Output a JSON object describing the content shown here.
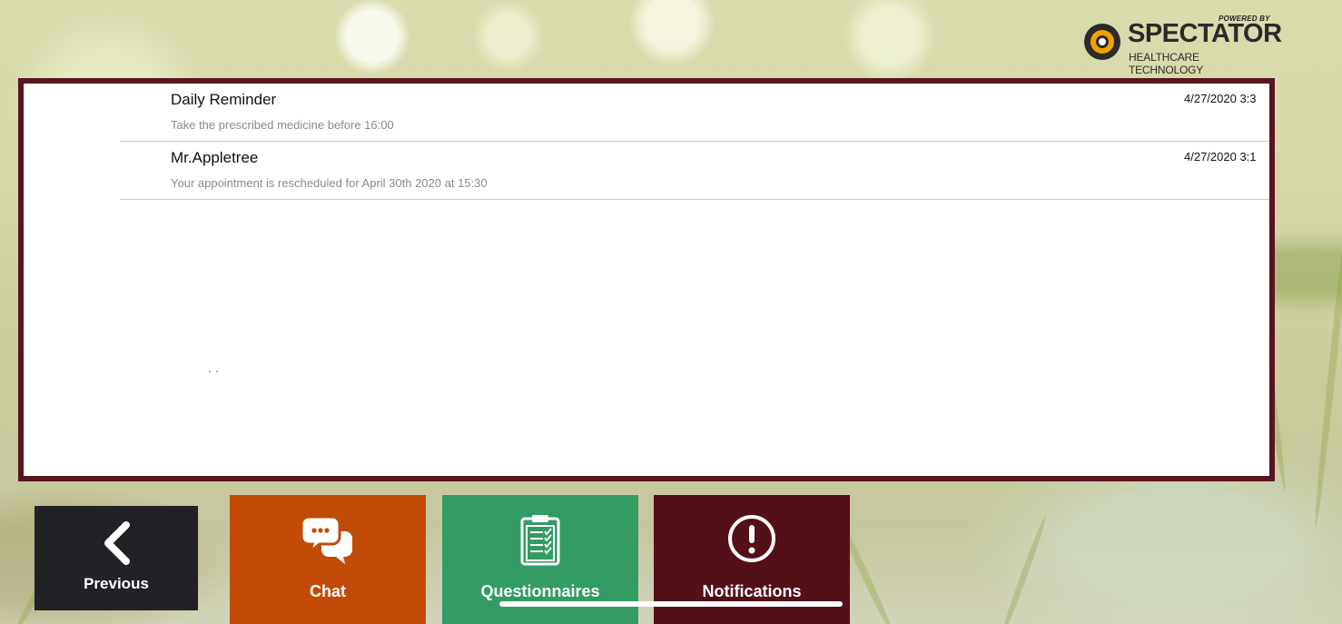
{
  "brand": {
    "powered_by": "POWERED BY",
    "name": "SPECTATOR",
    "tagline": "HEALTHCARE TECHNOLOGY",
    "icon": "spectator-logo-icon"
  },
  "notifications": [
    {
      "title": "Daily Reminder",
      "body": "Take the prescribed medicine before 16:00",
      "date": "4/27/2020 3:3"
    },
    {
      "title": "Mr.Appletree",
      "body": "Your appointment is rescheduled for April 30th 2020 at 15:30",
      "date": "4/27/2020 3:1"
    }
  ],
  "nav": {
    "previous": {
      "label": "Previous",
      "icon": "chevron-left-icon"
    },
    "chat": {
      "label": "Chat",
      "icon": "chat-bubbles-icon"
    },
    "questionnaires": {
      "label": "Questionnaires",
      "icon": "clipboard-icon"
    },
    "notifications": {
      "label": "Notifications",
      "icon": "exclamation-circle-icon"
    }
  },
  "colors": {
    "panel_border": "#5a1420",
    "previous": "#212126",
    "chat": "#c24b08",
    "questionnaires": "#339b64",
    "notifications": "#541019",
    "logo_accent": "#f2a100"
  }
}
